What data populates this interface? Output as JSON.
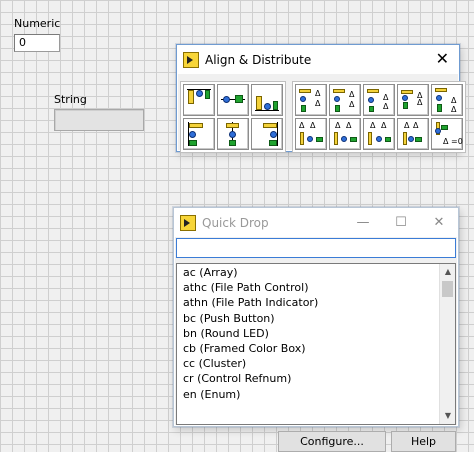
{
  "front_panel": {
    "numeric_label": "Numeric",
    "numeric_value": "0",
    "string_label": "String",
    "string_value": ""
  },
  "align_window": {
    "title": "Align & Distribute",
    "close_glyph": "✕",
    "align_tools": [
      "align-top-edges",
      "align-vertical-centers",
      "align-bottom-edges",
      "align-left-edges",
      "align-horizontal-centers",
      "align-right-edges"
    ],
    "distribute_tools": [
      "distribute-top-edges",
      "distribute-vertical-centers",
      "distribute-vertical-gaps",
      "distribute-vertical-compress",
      "distribute-bottom-edges",
      "distribute-left-edges",
      "distribute-horizontal-centers",
      "distribute-horizontal-gaps",
      "distribute-horizontal-compress",
      "distribute-right-edges"
    ]
  },
  "quick_drop": {
    "title": "Quick Drop",
    "minimize_glyph": "—",
    "maximize_glyph": "☐",
    "close_glyph": "✕",
    "search_value": "",
    "items": [
      "ac (Array)",
      "athc (File Path Control)",
      "athn (File Path Indicator)",
      "bc (Push Button)",
      "bn (Round LED)",
      "cb (Framed Color Box)",
      "cc (Cluster)",
      "cr (Control Refnum)",
      "en (Enum)"
    ],
    "configure_label": "Configure...",
    "help_label": "Help",
    "scroll_up_glyph": "▲",
    "scroll_down_glyph": "▼"
  }
}
